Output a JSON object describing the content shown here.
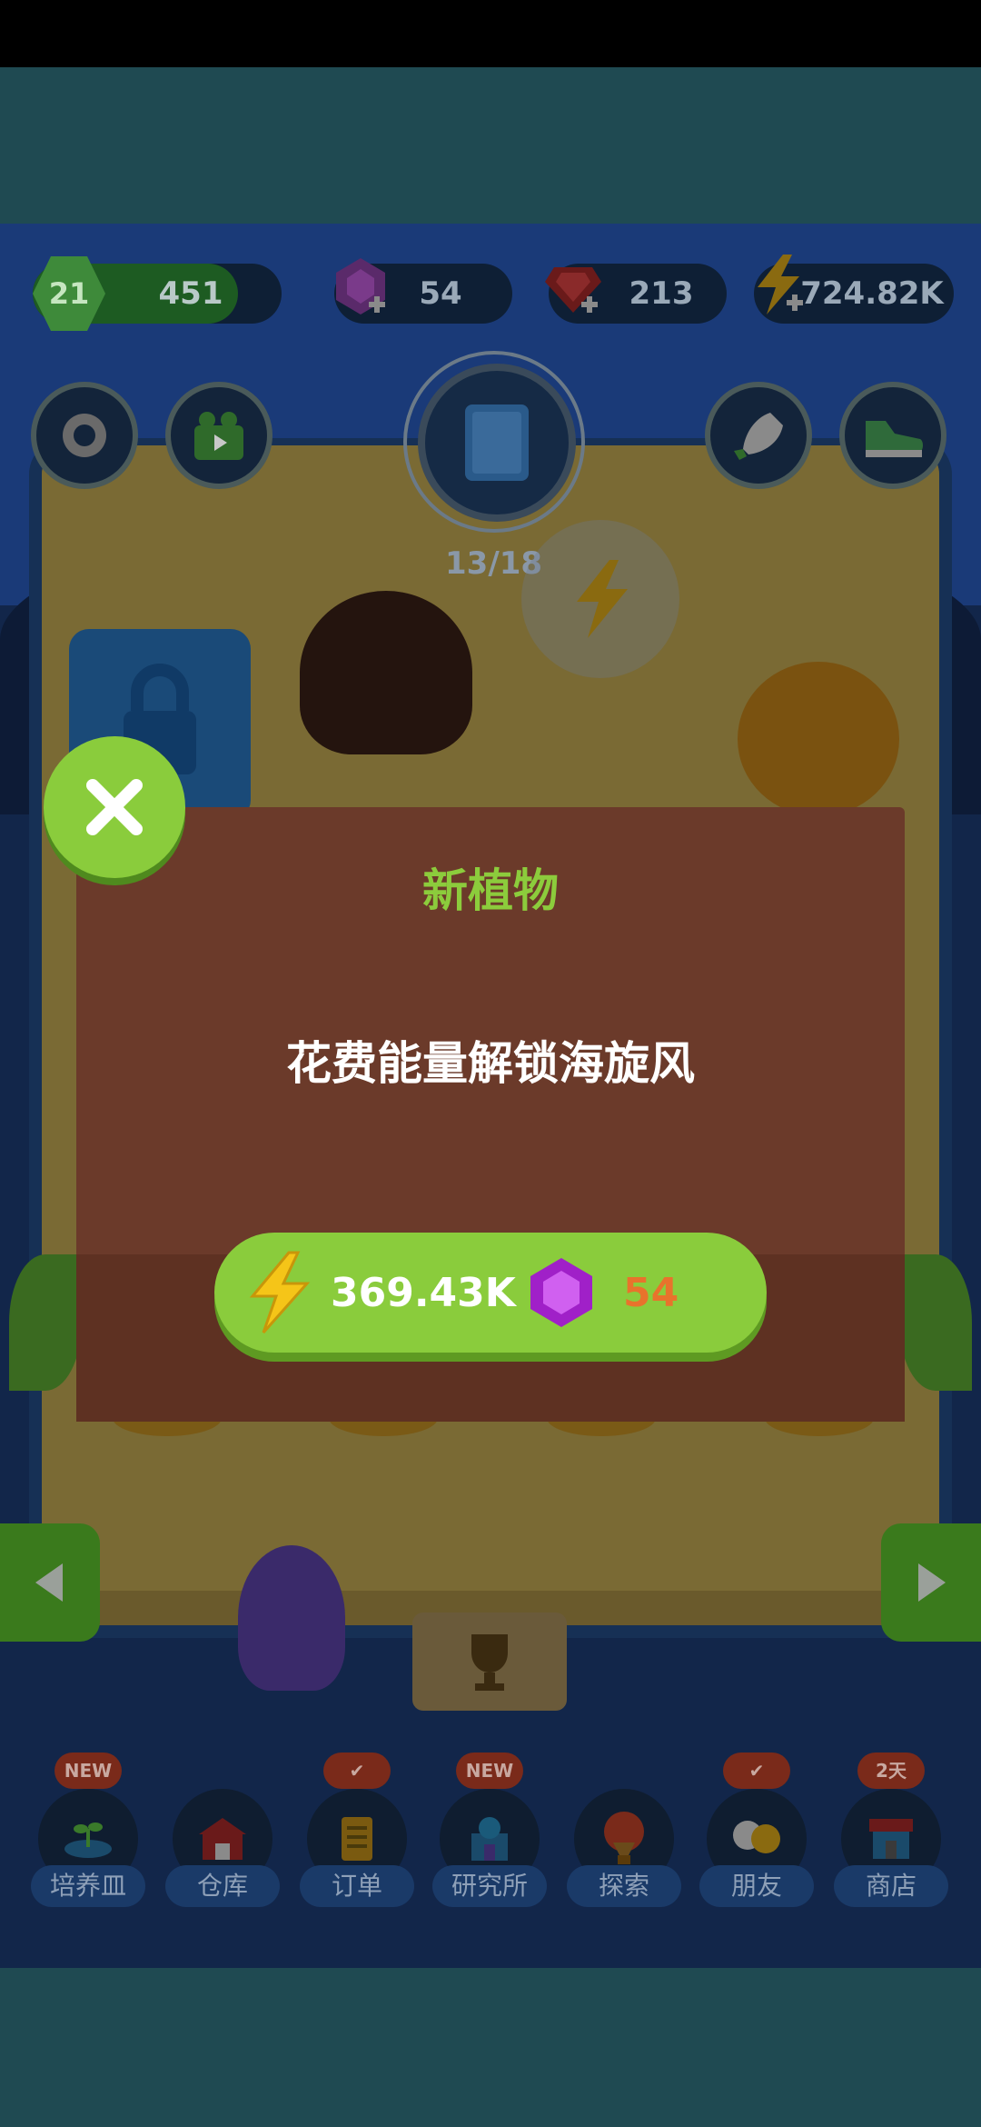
{
  "hud": {
    "level": "21",
    "xp": "451",
    "gems": "54",
    "rubies": "213",
    "energy": "724.82K",
    "plant_count": "13/18"
  },
  "nav": [
    {
      "label": "培养皿",
      "badge": "NEW"
    },
    {
      "label": "仓库",
      "badge": ""
    },
    {
      "label": "订单",
      "badge": "✔"
    },
    {
      "label": "研究所",
      "badge": "NEW"
    },
    {
      "label": "探索",
      "badge": ""
    },
    {
      "label": "朋友",
      "badge": "✔"
    },
    {
      "label": "商店",
      "badge": "2天"
    }
  ],
  "dialog": {
    "title": "新植物",
    "message": "花费能量解锁海旋风",
    "energy_cost": "369.43K",
    "gem_cost": "54"
  },
  "colors": {
    "accent_green": "#8acc3c",
    "dialog_brown": "#6b3a2a",
    "gem_cost_orange": "#e8732c"
  }
}
